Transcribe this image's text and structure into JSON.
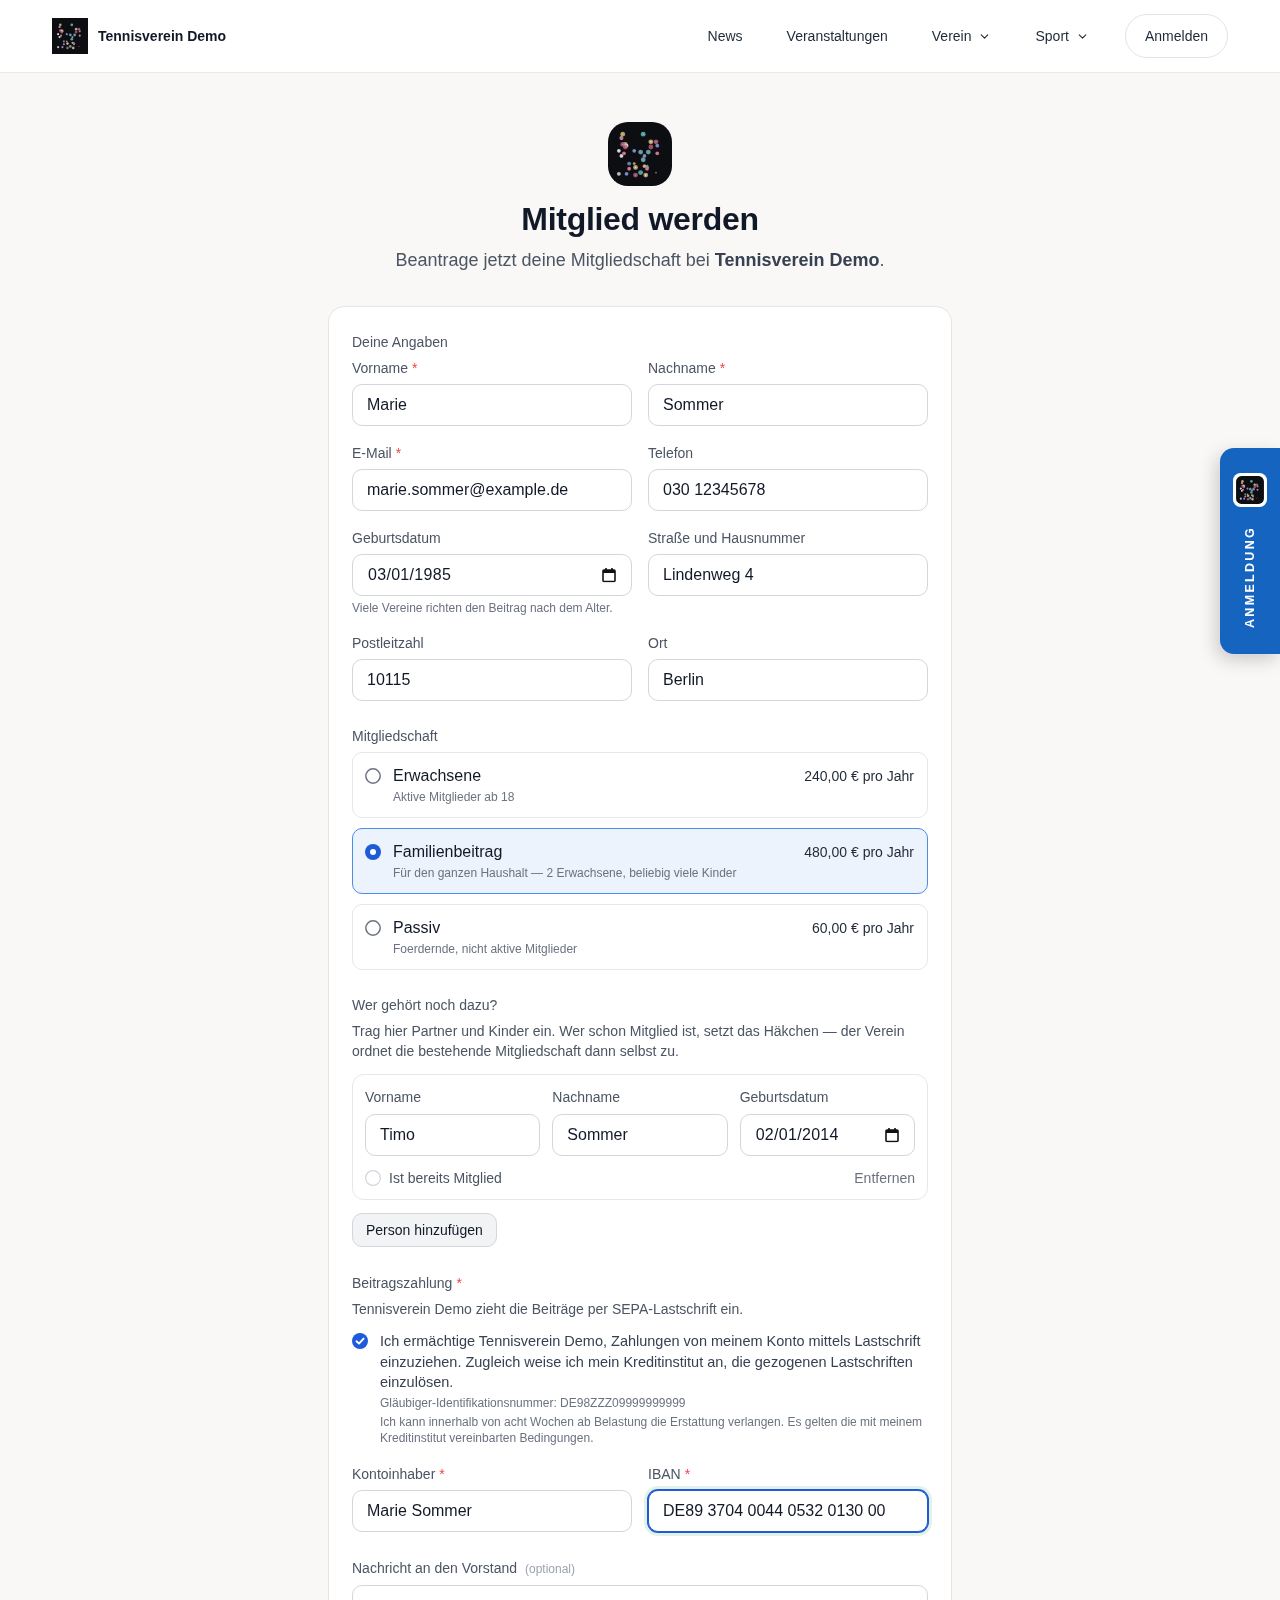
{
  "header": {
    "brand": "Tennisverein Demo",
    "nav": [
      {
        "label": "News",
        "dropdown": false
      },
      {
        "label": "Veranstaltungen",
        "dropdown": false
      },
      {
        "label": "Verein",
        "dropdown": true
      },
      {
        "label": "Sport",
        "dropdown": true
      }
    ],
    "login_button": "Anmelden"
  },
  "side_tab": {
    "label": "ANMELDUNG"
  },
  "hero": {
    "title": "Mitglied werden",
    "subtitle": "Beantrage jetzt deine Mitgliedschaft bei **Tennisverein Demo**."
  },
  "personal": {
    "heading": "Deine Angaben",
    "fields": [
      {
        "kind": "text",
        "label": "Vorname",
        "required_mark": "*",
        "value": "Marie"
      },
      {
        "kind": "text",
        "label": "Nachname",
        "required_mark": "*",
        "value": "Sommer"
      },
      {
        "kind": "text",
        "label": "E-Mail",
        "required_mark": "*",
        "value": "marie.sommer@example.de"
      },
      {
        "kind": "text",
        "label": "Telefon",
        "value": "030 12345678"
      },
      {
        "kind": "date",
        "label": "Geburtsdatum",
        "value": "03/01/1985",
        "hint": "Viele Vereine richten den Beitrag nach dem Alter."
      },
      {
        "kind": "text",
        "label": "Straße und Hausnummer",
        "value": "Lindenweg 4"
      },
      {
        "kind": "text",
        "label": "Postleitzahl",
        "value": "10115"
      },
      {
        "kind": "text",
        "label": "Ort",
        "value": "Berlin"
      }
    ]
  },
  "membership": {
    "heading": "Mitgliedschaft",
    "options": [
      {
        "name": "Erwachsene",
        "description": "Aktive Mitglieder ab 18",
        "price": "240,00 € pro Jahr",
        "selected": false
      },
      {
        "name": "Familienbeitrag",
        "description": "Für den ganzen Haushalt — 2 Erwachsene, beliebig viele Kinder",
        "price": "480,00 € pro Jahr",
        "selected": true
      },
      {
        "name": "Passiv",
        "description": "Foerdernde, nicht aktive Mitglieder",
        "price": "60,00 € pro Jahr",
        "selected": false
      }
    ]
  },
  "family": {
    "heading": "Wer gehört noch dazu?",
    "intro": "Trag hier Partner und Kinder ein. Wer schon Mitglied ist, setzt das Häkchen — der Verein ordnet die bestehende Mitgliedschaft dann selbst zu.",
    "members": [
      {
        "fields": [
          {
            "kind": "text",
            "label": "Vorname",
            "value": "Timo"
          },
          {
            "kind": "text",
            "label": "Nachname",
            "value": "Sommer"
          },
          {
            "kind": "date",
            "label": "Geburtsdatum",
            "value": "02/01/2014"
          }
        ],
        "existing_member": {
          "label": "Ist bereits Mitglied",
          "checked": false
        },
        "remove": "Entfernen"
      }
    ],
    "add_button": "Person hinzufügen"
  },
  "payment": {
    "heading": "Beitragszahlung",
    "required_mark": "*",
    "intro": "Tennisverein Demo zieht die Beiträge per SEPA-Lastschrift ein.",
    "mandate": {
      "checked": true,
      "text": "Ich ermächtige Tennisverein Demo, Zahlungen von meinem Konto mittels Lastschrift einzuziehen. Zugleich weise ich mein Kreditinstitut an, die gezogenen Lastschriften einzulösen.",
      "creditor_id": "Gläubiger-Identifikationsnummer: DE98ZZZ09999999999",
      "note": "Ich kann innerhalb von acht Wochen ab Belastung die Erstattung verlangen. Es gelten die mit meinem Kreditinstitut vereinbarten Bedingungen."
    },
    "fields": [
      {
        "label": "Kontoinhaber",
        "required_mark": "*",
        "value": "Marie Sommer",
        "focused": false
      },
      {
        "label": "IBAN",
        "required_mark": "*",
        "value": "DE89 3704 0044 0532 0130 00",
        "focused": true
      }
    ]
  },
  "message": {
    "label": "Nachricht an den Vorstand",
    "note": "(optional)"
  }
}
